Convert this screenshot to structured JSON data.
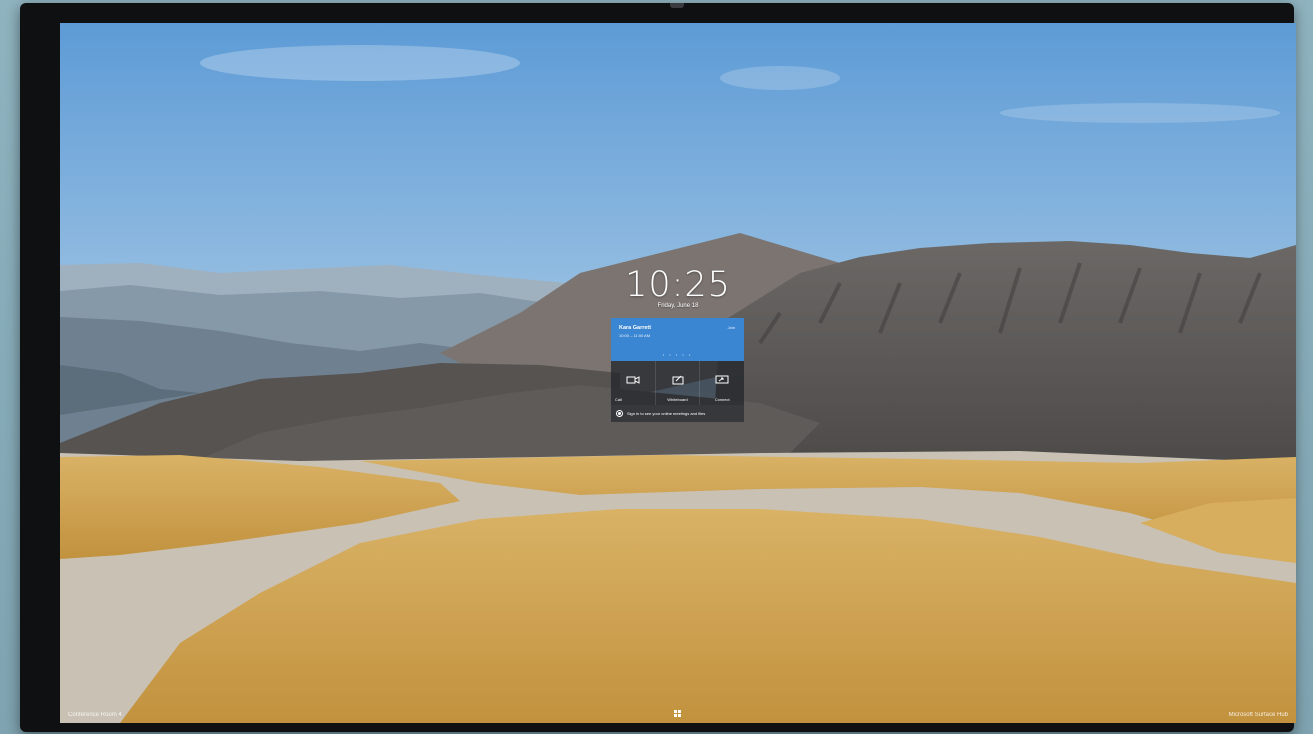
{
  "lock_screen": {
    "time": "10:25",
    "date": "Friday, June 18"
  },
  "meeting": {
    "organizer": "Kara Garrett",
    "time_range": "10:00 – 11:00 AM",
    "join_label": "Join",
    "page_dots": "• • • • •"
  },
  "actions": [
    {
      "label": "Call",
      "icon": "camera-icon"
    },
    {
      "label": "Whiteboard",
      "icon": "whiteboard-icon"
    },
    {
      "label": "Connect",
      "icon": "connect-icon"
    }
  ],
  "signin": {
    "text": "Sign in to see your online meetings and files"
  },
  "footer": {
    "room_name": "Conference Room 4",
    "device_name": "Microsoft Surface Hub",
    "start_icon": "windows-logo-icon"
  },
  "colors": {
    "meeting_card": "#3a86d2",
    "bezel": "#0f1012",
    "wall": "#8fb3bf"
  }
}
